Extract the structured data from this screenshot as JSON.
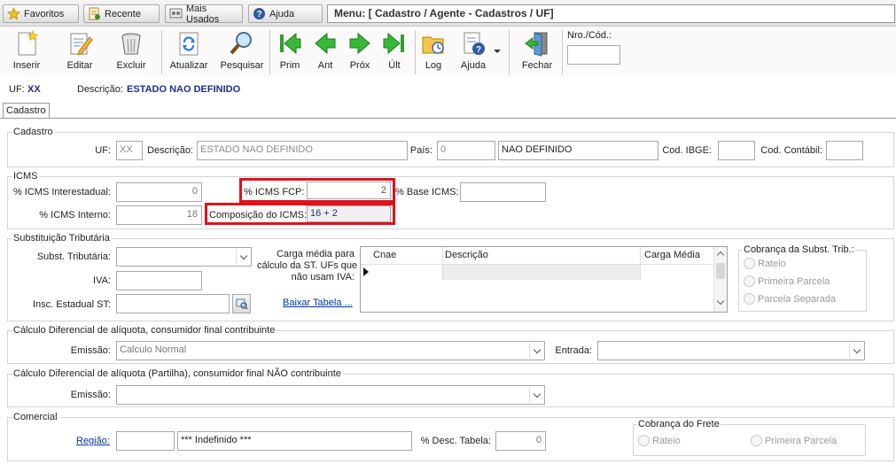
{
  "top_tabs": [
    {
      "label": "Favoritos"
    },
    {
      "label": "Recente"
    },
    {
      "label": "Mais Usados"
    },
    {
      "label": "Ajuda"
    }
  ],
  "menu_path": "Menu: [ Cadastro / Agente - Cadastros / UF]",
  "toolbar": {
    "inserir": "Inserir",
    "editar": "Editar",
    "excluir": "Excluir",
    "atualizar": "Atualizar",
    "pesquisar": "Pesquisar",
    "prim": "Prim",
    "ant": "Ant",
    "prox": "Próx",
    "ult": "Últ",
    "log": "Log",
    "ajuda": "Ajuda",
    "fechar": "Fechar",
    "nro_label": "Nro./Cód.:",
    "nro_value": ""
  },
  "info": {
    "uf_label": "UF:",
    "uf_value": "XX",
    "desc_label": "Descrição:",
    "desc_value": "ESTADO NAO DEFINIDO"
  },
  "tab": "Cadastro",
  "cadastro": {
    "title": "Cadastro",
    "uf_label": "UF:",
    "uf_value": "XX",
    "desc_label": "Descrição:",
    "desc_value": "ESTADO NAO DEFINIDO",
    "pais_label": "País:",
    "pais_code": "0",
    "pais_name": "NAO DEFINIDO",
    "ibge_label": "Cod. IBGE:",
    "ibge_value": "",
    "contabil_label": "Cod. Contábil:",
    "contabil_value": ""
  },
  "icms": {
    "title": "ICMS",
    "interestadual_label": "% ICMS Interestadual:",
    "interestadual_value": "0",
    "interno_label": "% ICMS Interno:",
    "interno_value": "18",
    "fcp_label": "% ICMS FCP:",
    "fcp_value": "2",
    "base_label": "% Base ICMS:",
    "base_value": "",
    "composicao_label": "Composição do ICMS:",
    "composicao_value": "16 + 2"
  },
  "subst": {
    "title": "Substituição Tributária",
    "subst_label": "Subst. Tributária:",
    "subst_value": "",
    "iva_label": "IVA:",
    "iva_value": "",
    "insc_label": "Insc. Estadual ST:",
    "insc_value": "",
    "carga_label_1": "Carga média para",
    "carga_label_2": "cálculo da ST. UFs que",
    "carga_label_3": "não usam IVA:",
    "baixar": "Baixar Tabela ...",
    "grid_headers": [
      "Cnae",
      "Descrição",
      "Carga Média"
    ],
    "cobranca_title": "Cobrança da Subst. Trib.:",
    "cobranca_options": [
      "Rateio",
      "Primeira Parcela",
      "Parcela Separada"
    ]
  },
  "difal_contrib": {
    "title": "Cálculo Diferencial de alíquota, consumidor final contribuinte",
    "emissao_label": "Emissão:",
    "emissao_value": "Calculo Normal",
    "entrada_label": "Entrada:",
    "entrada_value": ""
  },
  "difal_nao": {
    "title": "Cálculo Diferencial de alíquota (Partilha), consumidor final NÃO contribuinte",
    "emissao_label": "Emissão:",
    "emissao_value": ""
  },
  "comercial": {
    "title": "Comercial",
    "regiao_label": "Região:",
    "regiao_code": "",
    "regiao_name": "*** Indefinido ***",
    "desc_tabela_label": "% Desc. Tabela:",
    "desc_tabela_value": "0",
    "frete_title": "Cobrança do Frete",
    "frete_options": [
      "Rateio",
      "Primeira Parcela"
    ]
  }
}
